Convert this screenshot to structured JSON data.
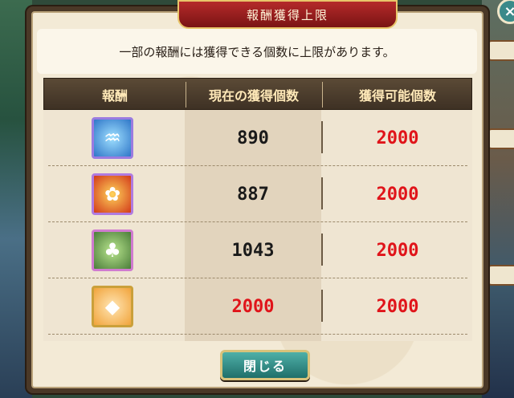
{
  "dialog": {
    "title": "報酬獲得上限",
    "notice": "一部の報酬には獲得できる個数に上限があります。",
    "close_button": "閉じる",
    "close_x": "×"
  },
  "table": {
    "headers": [
      "報酬",
      "現在の獲得個数",
      "獲得可能個数"
    ],
    "rows": [
      {
        "icon": "blue-mermaid-character-icon",
        "current": "890",
        "max": "2000"
      },
      {
        "icon": "red-flower-character-icon",
        "current": "887",
        "max": "2000"
      },
      {
        "icon": "green-hooded-character-icon",
        "current": "1043",
        "max": "2000"
      },
      {
        "icon": "pink-fish-character-icon",
        "current": "2000",
        "max": "2000"
      }
    ]
  },
  "colors": {
    "limit_red": "#e0141a",
    "normal_black": "#1a1a1a"
  }
}
